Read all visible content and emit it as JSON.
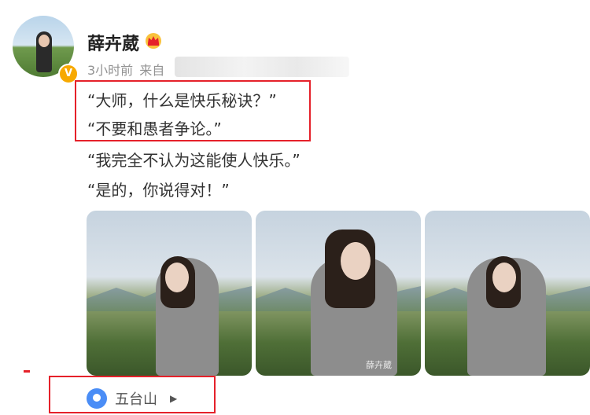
{
  "post": {
    "username": "薛卉葳",
    "time": "3小时前",
    "source_prefix": "来自",
    "lines": [
      "“大师，什么是快乐秘诀？”",
      "“不要和愚者争论。”",
      "“我完全不认为这能使人快乐。”",
      "“是的，你说得对！”"
    ],
    "photos": [
      {
        "name": "photo-1",
        "watermark": ""
      },
      {
        "name": "photo-2",
        "watermark": "薛卉葳"
      },
      {
        "name": "photo-3",
        "watermark": ""
      }
    ],
    "location": "五台山",
    "location_chevron": "▶"
  },
  "icons": {
    "verify": "verified-badge-icon",
    "crown": "crown-icon",
    "pin": "location-pin-icon",
    "chevron": "chevron-right-icon"
  },
  "colors": {
    "highlight": "#e5212a",
    "badge": "#f7a900",
    "pin": "#4a8df6"
  }
}
